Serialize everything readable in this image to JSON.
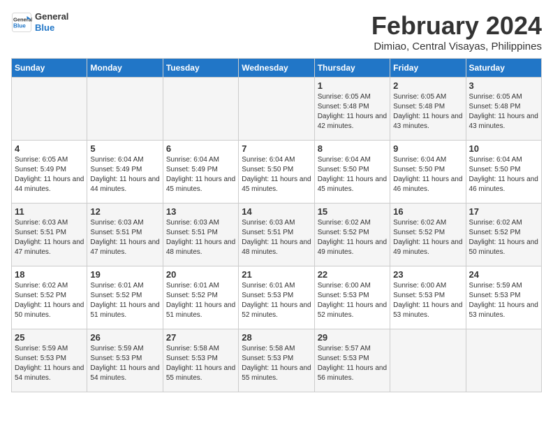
{
  "header": {
    "logo_line1": "General",
    "logo_line2": "Blue",
    "month_year": "February 2024",
    "location": "Dimiao, Central Visayas, Philippines"
  },
  "weekdays": [
    "Sunday",
    "Monday",
    "Tuesday",
    "Wednesday",
    "Thursday",
    "Friday",
    "Saturday"
  ],
  "weeks": [
    [
      {
        "day": "",
        "info": ""
      },
      {
        "day": "",
        "info": ""
      },
      {
        "day": "",
        "info": ""
      },
      {
        "day": "",
        "info": ""
      },
      {
        "day": "1",
        "info": "Sunrise: 6:05 AM\nSunset: 5:48 PM\nDaylight: 11 hours and 42 minutes."
      },
      {
        "day": "2",
        "info": "Sunrise: 6:05 AM\nSunset: 5:48 PM\nDaylight: 11 hours and 43 minutes."
      },
      {
        "day": "3",
        "info": "Sunrise: 6:05 AM\nSunset: 5:48 PM\nDaylight: 11 hours and 43 minutes."
      }
    ],
    [
      {
        "day": "4",
        "info": "Sunrise: 6:05 AM\nSunset: 5:49 PM\nDaylight: 11 hours and 44 minutes."
      },
      {
        "day": "5",
        "info": "Sunrise: 6:04 AM\nSunset: 5:49 PM\nDaylight: 11 hours and 44 minutes."
      },
      {
        "day": "6",
        "info": "Sunrise: 6:04 AM\nSunset: 5:49 PM\nDaylight: 11 hours and 45 minutes."
      },
      {
        "day": "7",
        "info": "Sunrise: 6:04 AM\nSunset: 5:50 PM\nDaylight: 11 hours and 45 minutes."
      },
      {
        "day": "8",
        "info": "Sunrise: 6:04 AM\nSunset: 5:50 PM\nDaylight: 11 hours and 45 minutes."
      },
      {
        "day": "9",
        "info": "Sunrise: 6:04 AM\nSunset: 5:50 PM\nDaylight: 11 hours and 46 minutes."
      },
      {
        "day": "10",
        "info": "Sunrise: 6:04 AM\nSunset: 5:50 PM\nDaylight: 11 hours and 46 minutes."
      }
    ],
    [
      {
        "day": "11",
        "info": "Sunrise: 6:03 AM\nSunset: 5:51 PM\nDaylight: 11 hours and 47 minutes."
      },
      {
        "day": "12",
        "info": "Sunrise: 6:03 AM\nSunset: 5:51 PM\nDaylight: 11 hours and 47 minutes."
      },
      {
        "day": "13",
        "info": "Sunrise: 6:03 AM\nSunset: 5:51 PM\nDaylight: 11 hours and 48 minutes."
      },
      {
        "day": "14",
        "info": "Sunrise: 6:03 AM\nSunset: 5:51 PM\nDaylight: 11 hours and 48 minutes."
      },
      {
        "day": "15",
        "info": "Sunrise: 6:02 AM\nSunset: 5:52 PM\nDaylight: 11 hours and 49 minutes."
      },
      {
        "day": "16",
        "info": "Sunrise: 6:02 AM\nSunset: 5:52 PM\nDaylight: 11 hours and 49 minutes."
      },
      {
        "day": "17",
        "info": "Sunrise: 6:02 AM\nSunset: 5:52 PM\nDaylight: 11 hours and 50 minutes."
      }
    ],
    [
      {
        "day": "18",
        "info": "Sunrise: 6:02 AM\nSunset: 5:52 PM\nDaylight: 11 hours and 50 minutes."
      },
      {
        "day": "19",
        "info": "Sunrise: 6:01 AM\nSunset: 5:52 PM\nDaylight: 11 hours and 51 minutes."
      },
      {
        "day": "20",
        "info": "Sunrise: 6:01 AM\nSunset: 5:52 PM\nDaylight: 11 hours and 51 minutes."
      },
      {
        "day": "21",
        "info": "Sunrise: 6:01 AM\nSunset: 5:53 PM\nDaylight: 11 hours and 52 minutes."
      },
      {
        "day": "22",
        "info": "Sunrise: 6:00 AM\nSunset: 5:53 PM\nDaylight: 11 hours and 52 minutes."
      },
      {
        "day": "23",
        "info": "Sunrise: 6:00 AM\nSunset: 5:53 PM\nDaylight: 11 hours and 53 minutes."
      },
      {
        "day": "24",
        "info": "Sunrise: 5:59 AM\nSunset: 5:53 PM\nDaylight: 11 hours and 53 minutes."
      }
    ],
    [
      {
        "day": "25",
        "info": "Sunrise: 5:59 AM\nSunset: 5:53 PM\nDaylight: 11 hours and 54 minutes."
      },
      {
        "day": "26",
        "info": "Sunrise: 5:59 AM\nSunset: 5:53 PM\nDaylight: 11 hours and 54 minutes."
      },
      {
        "day": "27",
        "info": "Sunrise: 5:58 AM\nSunset: 5:53 PM\nDaylight: 11 hours and 55 minutes."
      },
      {
        "day": "28",
        "info": "Sunrise: 5:58 AM\nSunset: 5:53 PM\nDaylight: 11 hours and 55 minutes."
      },
      {
        "day": "29",
        "info": "Sunrise: 5:57 AM\nSunset: 5:53 PM\nDaylight: 11 hours and 56 minutes."
      },
      {
        "day": "",
        "info": ""
      },
      {
        "day": "",
        "info": ""
      }
    ]
  ]
}
